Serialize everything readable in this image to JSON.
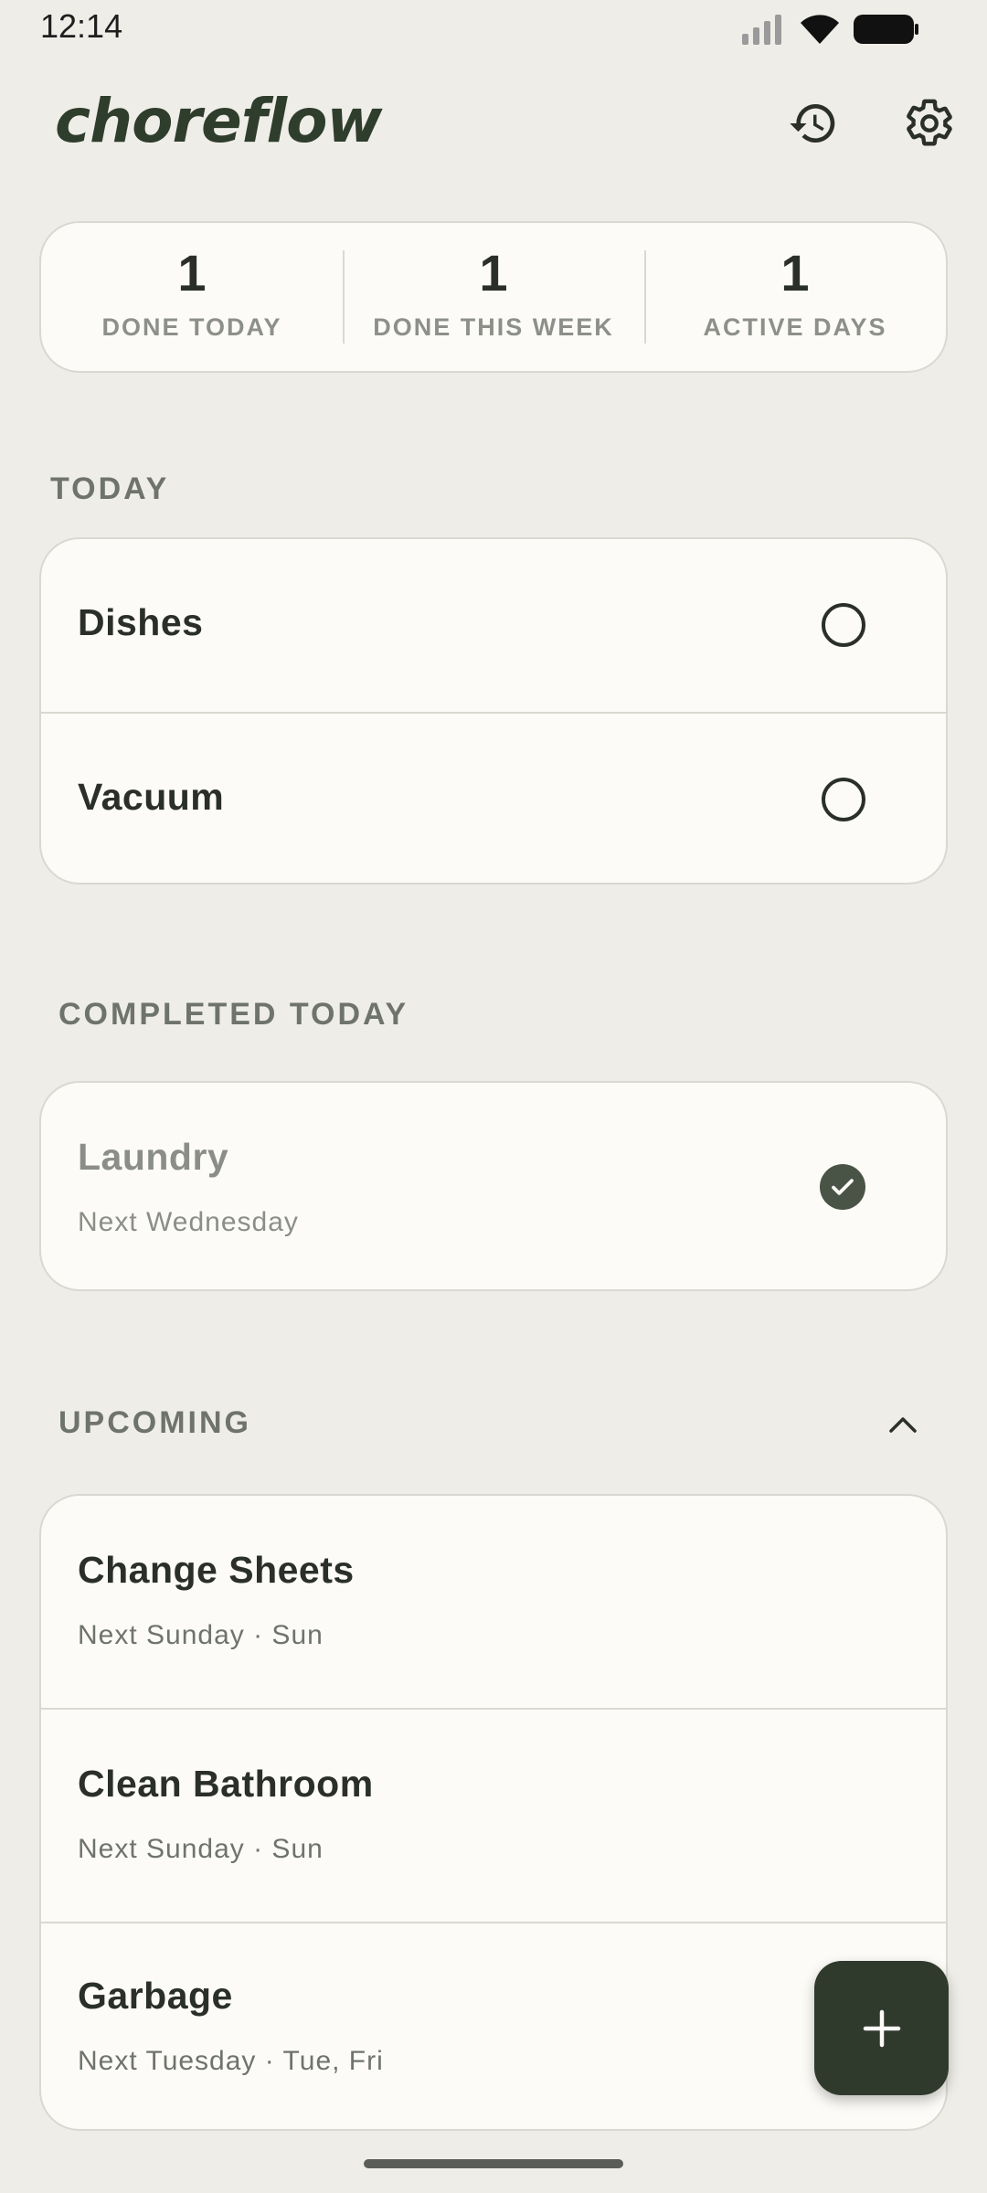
{
  "status_bar": {
    "time": "12:14"
  },
  "header": {
    "logo": "choreflow",
    "history_icon": "history-icon",
    "settings_icon": "gear-icon"
  },
  "stats": [
    {
      "value": "1",
      "label": "DONE TODAY"
    },
    {
      "value": "1",
      "label": "DONE THIS WEEK"
    },
    {
      "value": "1",
      "label": "ACTIVE DAYS"
    }
  ],
  "today": {
    "title": "TODAY",
    "items": [
      {
        "name": "Dishes",
        "done": false
      },
      {
        "name": "Vacuum",
        "done": false
      }
    ]
  },
  "completed": {
    "title": "COMPLETED TODAY",
    "items": [
      {
        "name": "Laundry",
        "sub": "Next Wednesday",
        "done": true
      }
    ]
  },
  "upcoming": {
    "title": "UPCOMING",
    "collapse_icon": "chevron-up-icon",
    "items": [
      {
        "name": "Change Sheets",
        "sub": "Next Sunday · Sun"
      },
      {
        "name": "Clean Bathroom",
        "sub": "Next Sunday · Sun"
      },
      {
        "name": "Garbage",
        "sub": "Next Tuesday · Tue, Fri"
      }
    ]
  },
  "fab": {
    "icon": "plus-icon"
  },
  "colors": {
    "background": "#efede8",
    "card": "#fcfbf7",
    "accent": "#2f3a2c",
    "muted": "#6f736d"
  }
}
